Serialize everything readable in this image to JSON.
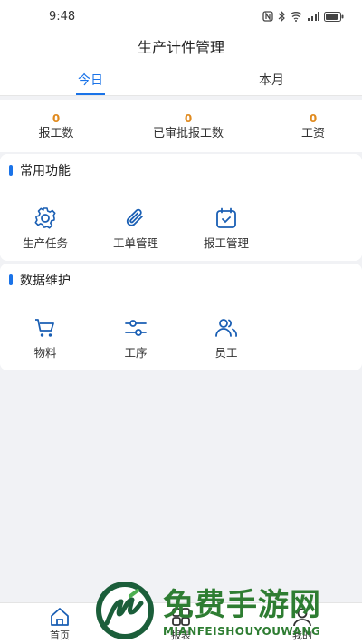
{
  "status_bar": {
    "time": "9:48"
  },
  "header": {
    "title": "生产计件管理"
  },
  "tabs": [
    {
      "label": "今日",
      "active": true
    },
    {
      "label": "本月",
      "active": false
    }
  ],
  "stats": [
    {
      "value": "0",
      "label": "报工数"
    },
    {
      "value": "0",
      "label": "已审批报工数"
    },
    {
      "value": "0",
      "label": "工资"
    }
  ],
  "sections": {
    "common": {
      "title": "常用功能",
      "items": [
        {
          "label": "生产任务",
          "icon": "gear-icon"
        },
        {
          "label": "工单管理",
          "icon": "paperclip-icon"
        },
        {
          "label": "报工管理",
          "icon": "calendar-check-icon"
        }
      ]
    },
    "data": {
      "title": "数据维护",
      "items": [
        {
          "label": "物料",
          "icon": "cart-icon"
        },
        {
          "label": "工序",
          "icon": "sliders-icon"
        },
        {
          "label": "员工",
          "icon": "users-icon"
        }
      ]
    }
  },
  "bottom_nav": [
    {
      "label": "首页",
      "icon": "home-icon"
    },
    {
      "label": "报表",
      "icon": "grid-icon"
    },
    {
      "label": "我的",
      "icon": "user-icon"
    }
  ],
  "watermark": {
    "main": "免费手游网",
    "sub": "MIANFEISHOUYOUWANG"
  },
  "colors": {
    "accent": "#1a73e8",
    "stat_value": "#e08a1e",
    "watermark": "#2e7d32"
  }
}
